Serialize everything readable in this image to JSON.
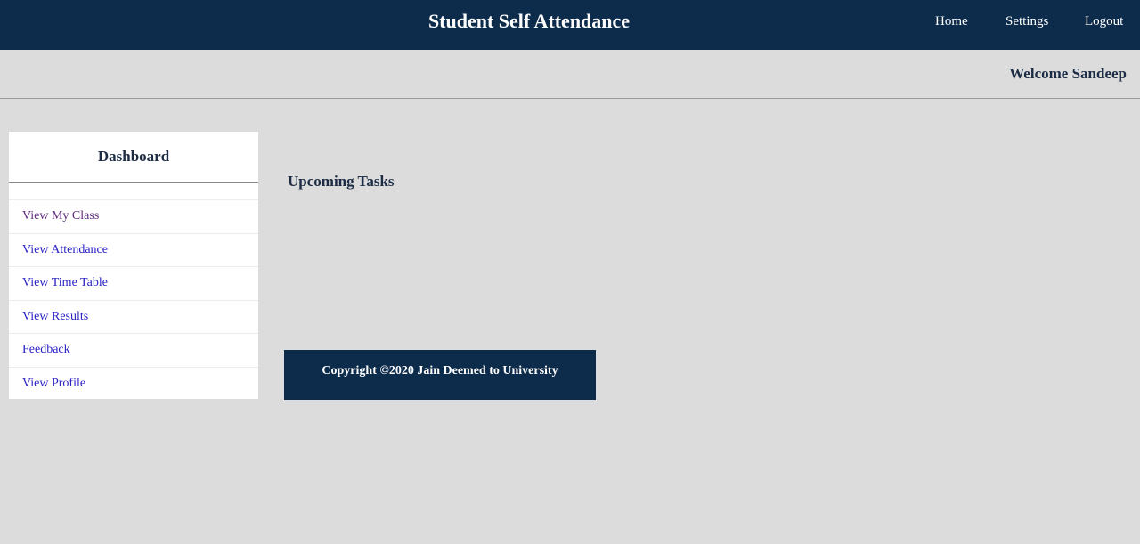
{
  "header": {
    "title": "Student Self Attendance",
    "nav": {
      "home": "Home",
      "settings": "Settings",
      "logout": "Logout"
    },
    "background_color": "#0d2b4b"
  },
  "welcome": {
    "text": "Welcome Sandeep"
  },
  "sidebar": {
    "title": "Dashboard",
    "items": [
      {
        "label": "View My Class",
        "visited": true
      },
      {
        "label": "View Attendance",
        "visited": false
      },
      {
        "label": "View Time Table",
        "visited": false
      },
      {
        "label": "View Results",
        "visited": false
      },
      {
        "label": "Feedback",
        "visited": false
      },
      {
        "label": "View Profile",
        "visited": false
      }
    ],
    "link_color": "#2a23c4",
    "visited_color": "#5e2a7a"
  },
  "main": {
    "heading": "Upcoming Tasks"
  },
  "footer": {
    "text": "Copyright ©2020 Jain Deemed to University"
  }
}
